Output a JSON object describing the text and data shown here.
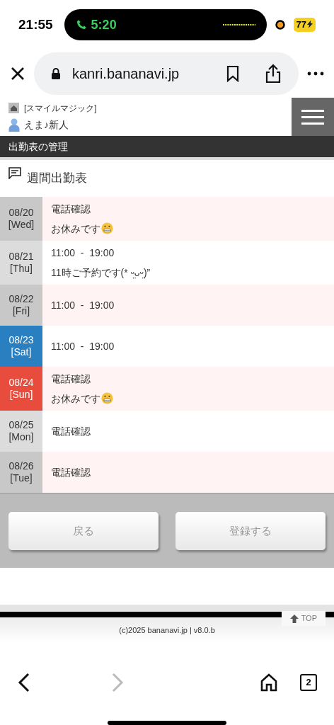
{
  "status_bar": {
    "time": "21:55",
    "call_time": "5:20",
    "battery": "77"
  },
  "browser": {
    "url": "kanri.bananavi.jp",
    "tab_count": "2"
  },
  "header": {
    "shop": "[スマイルマジック]",
    "user": "えま♪新人"
  },
  "page_title": "出勤表の管理",
  "section_title": "週間出勤表",
  "days": [
    {
      "date": "08/20",
      "weekday": "[Wed]",
      "kind": "weekday",
      "lines": [
        {
          "text": "電話確認"
        },
        {
          "text": "お休みです",
          "emoji": true
        }
      ]
    },
    {
      "date": "08/21",
      "weekday": "[Thu]",
      "kind": "weekday",
      "lines": [
        {
          "text": "11:00  -  19:00"
        },
        {
          "text": "11時ご予約です(* ᵕ̤ᴗᵕ̤)”"
        }
      ]
    },
    {
      "date": "08/22",
      "weekday": "[Fri]",
      "kind": "weekday",
      "lines": [
        {
          "text": "11:00  -  19:00"
        }
      ]
    },
    {
      "date": "08/23",
      "weekday": "[Sat]",
      "kind": "saturday",
      "lines": [
        {
          "text": "11:00  -  19:00"
        }
      ]
    },
    {
      "date": "08/24",
      "weekday": "[Sun]",
      "kind": "sunday",
      "lines": [
        {
          "text": "電話確認"
        },
        {
          "text": "お休みです",
          "emoji": true
        }
      ]
    },
    {
      "date": "08/25",
      "weekday": "[Mon]",
      "kind": "weekday",
      "lines": [
        {
          "text": "電話確認"
        }
      ]
    },
    {
      "date": "08/26",
      "weekday": "[Tue]",
      "kind": "weekday",
      "lines": [
        {
          "text": "電話確認"
        }
      ]
    }
  ],
  "buttons": [
    "戻る",
    "登録する"
  ],
  "top_link": "TOP",
  "footer": "(c)2025 bananavi.jp | v8.0.b"
}
